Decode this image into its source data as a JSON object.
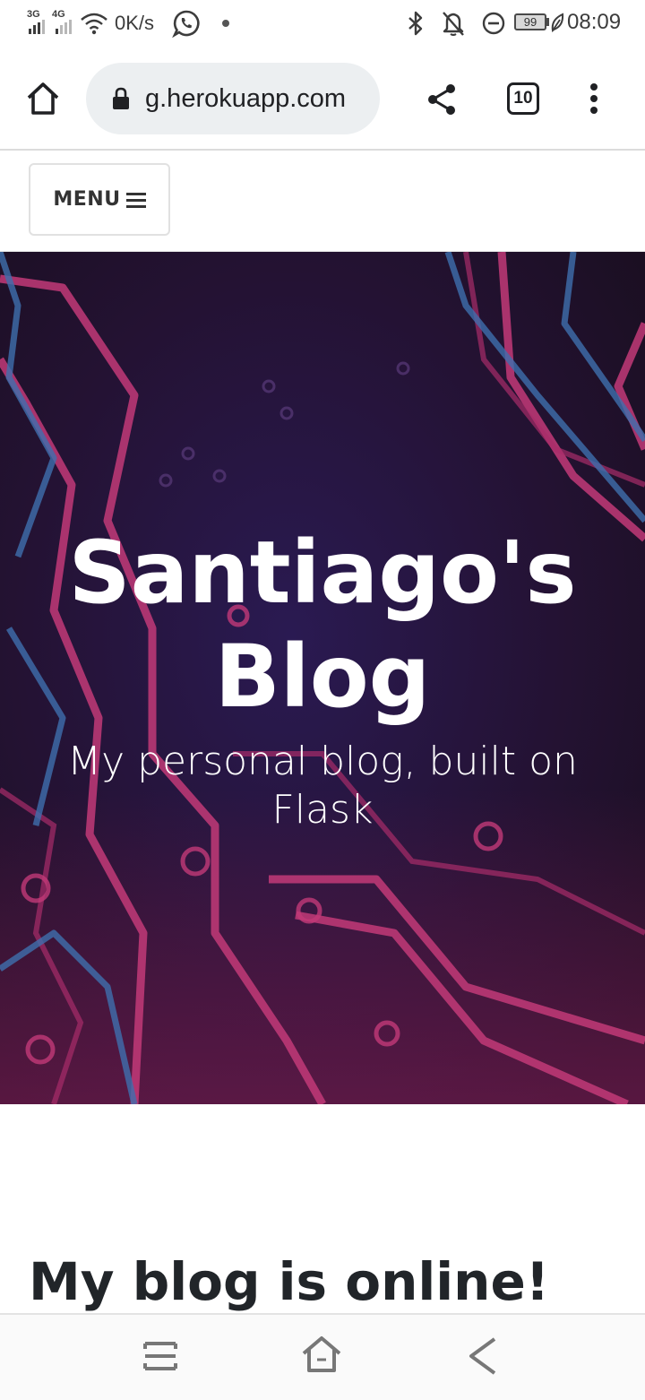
{
  "status_bar": {
    "network_1": "3G",
    "network_2": "4G",
    "speed": "0K/s",
    "battery": "99",
    "time": "08:09"
  },
  "browser": {
    "url": "g.herokuapp.com",
    "tab_count": "10"
  },
  "site": {
    "menu_label": "MENU",
    "hero_title": "Santiago's Blog",
    "hero_subtitle": "My personal blog, built on Flask",
    "post_title": "My blog is online!"
  },
  "icons": [
    "signal-icon",
    "wifi-icon",
    "whatsapp-icon",
    "bluetooth-icon",
    "bell-off-icon",
    "do-not-disturb-icon",
    "battery-icon",
    "leaf-icon",
    "home-icon",
    "lock-icon",
    "share-icon",
    "tab-count-icon",
    "more-vert-icon",
    "hamburger-icon",
    "recent-apps-icon",
    "android-home-icon",
    "back-icon"
  ],
  "colors": {
    "hero_bg": "#241233",
    "circuit_pink": "#c23a78",
    "circuit_blue": "#3f6fae",
    "text_dark": "#212529"
  }
}
